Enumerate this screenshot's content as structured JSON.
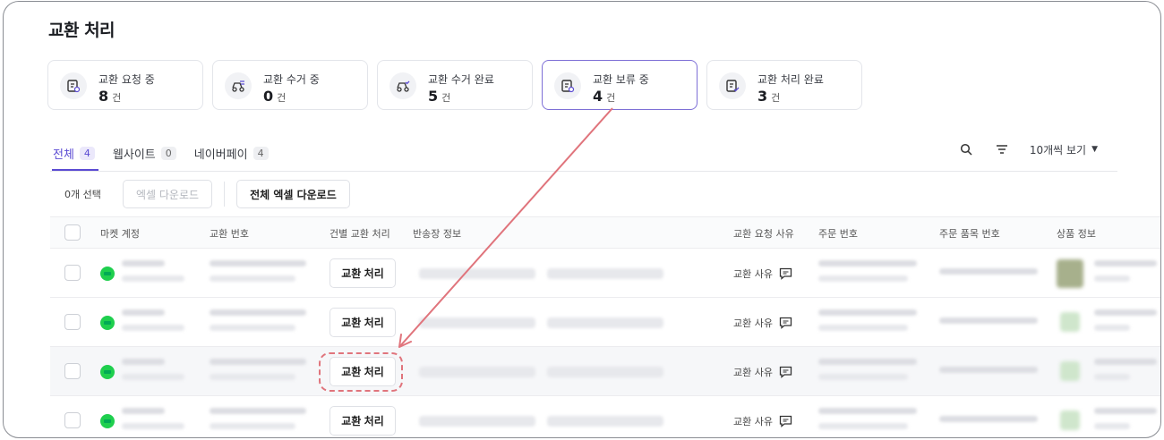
{
  "page": {
    "title": "교환 처리"
  },
  "cards": [
    {
      "label": "교환 요청 중",
      "count": "8",
      "unit": "건",
      "icon": "exchange-request-icon"
    },
    {
      "label": "교환 수거 중",
      "count": "0",
      "unit": "건",
      "icon": "pickup-in-progress-icon"
    },
    {
      "label": "교환 수거 완료",
      "count": "5",
      "unit": "건",
      "icon": "pickup-complete-icon"
    },
    {
      "label": "교환 보류 중",
      "count": "4",
      "unit": "건",
      "icon": "exchange-hold-icon"
    },
    {
      "label": "교환 처리 완료",
      "count": "3",
      "unit": "건",
      "icon": "exchange-done-icon"
    }
  ],
  "tabs": [
    {
      "label": "전체",
      "count": "4"
    },
    {
      "label": "웹사이트",
      "count": "0"
    },
    {
      "label": "네이버페이",
      "count": "4"
    }
  ],
  "toolbar": {
    "view_label": "10개씩 보기"
  },
  "actions": {
    "selected": "0개 선택",
    "excel_download": "엑셀 다운로드",
    "excel_download_all": "전체 엑셀 다운로드"
  },
  "table": {
    "headers": [
      "마켓 계정",
      "교환 번호",
      "건별 교환 처리",
      "반송장 정보",
      "교환 요청 사유",
      "주문 번호",
      "주문 품목 번호",
      "상품 정보"
    ],
    "rows": [
      {
        "action": "교환 처리",
        "reason": "교환 사유"
      },
      {
        "action": "교환 처리",
        "reason": "교환 사유"
      },
      {
        "action": "교환 처리",
        "reason": "교환 사유"
      },
      {
        "action": "교환 처리",
        "reason": "교환 사유"
      }
    ]
  },
  "colors": {
    "accent": "#5b4bd3",
    "highlight": "#e0747c",
    "market": "#1fcf4e"
  }
}
